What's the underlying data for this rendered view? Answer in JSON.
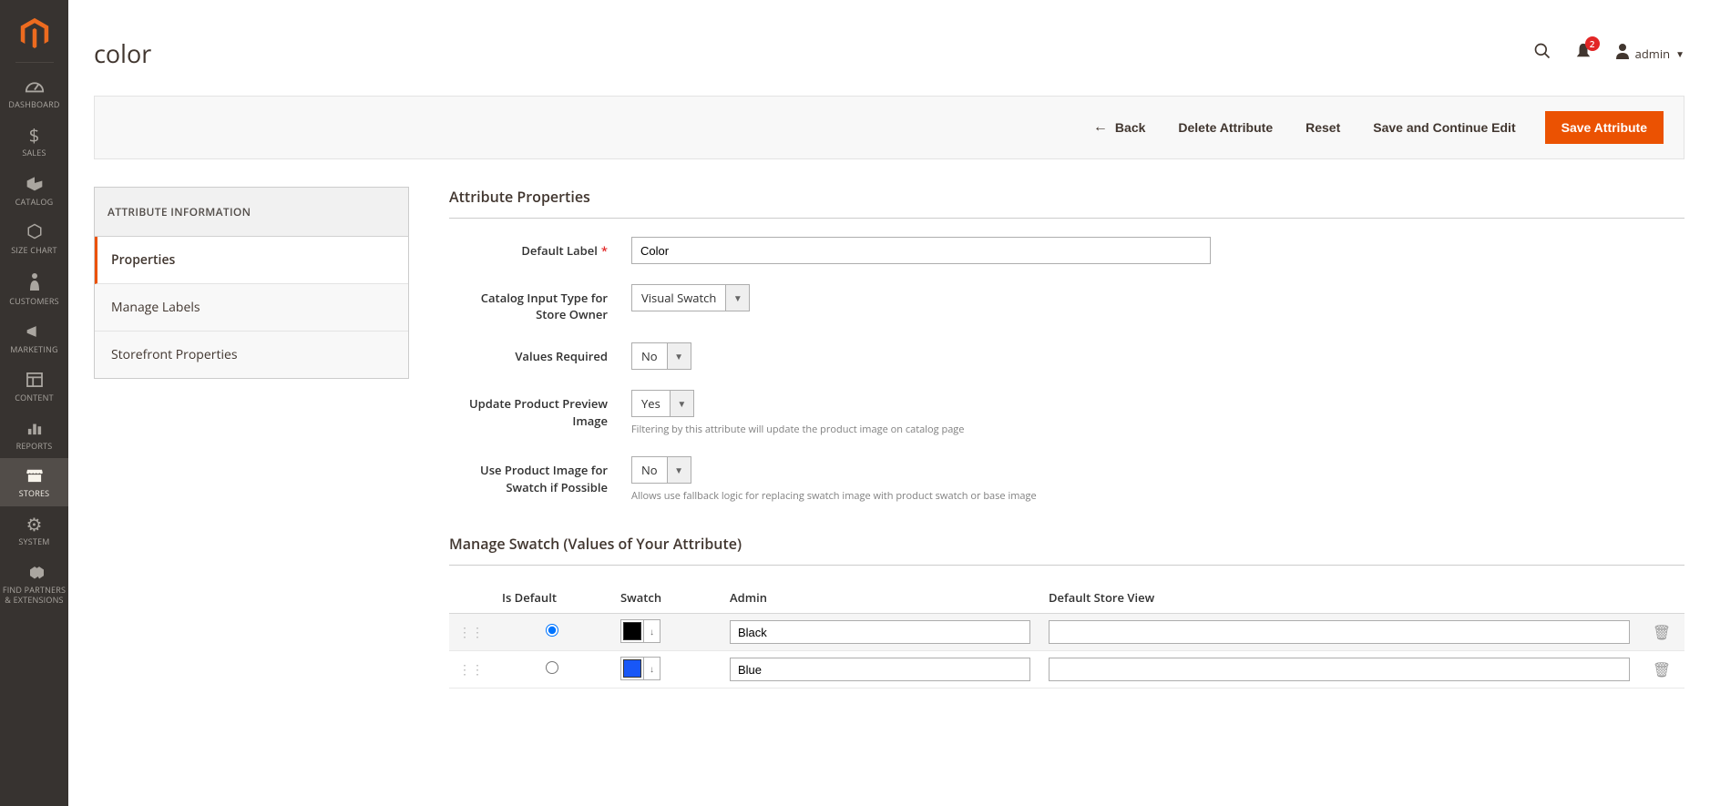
{
  "sidebar": {
    "items": [
      {
        "label": "DASHBOARD"
      },
      {
        "label": "SALES"
      },
      {
        "label": "CATALOG"
      },
      {
        "label": "SIZE CHART"
      },
      {
        "label": "CUSTOMERS"
      },
      {
        "label": "MARKETING"
      },
      {
        "label": "CONTENT"
      },
      {
        "label": "REPORTS"
      },
      {
        "label": "STORES"
      },
      {
        "label": "SYSTEM"
      },
      {
        "label": "FIND PARTNERS & EXTENSIONS"
      }
    ]
  },
  "header": {
    "title": "color",
    "notif_count": "2",
    "username": "admin"
  },
  "actions": {
    "back": "Back",
    "delete": "Delete Attribute",
    "reset": "Reset",
    "save_continue": "Save and Continue Edit",
    "save": "Save Attribute"
  },
  "tabs": {
    "header": "ATTRIBUTE INFORMATION",
    "items": [
      {
        "label": "Properties"
      },
      {
        "label": "Manage Labels"
      },
      {
        "label": "Storefront Properties"
      }
    ]
  },
  "form": {
    "section_title": "Attribute Properties",
    "default_label": {
      "label": "Default Label",
      "value": "Color"
    },
    "input_type": {
      "label": "Catalog Input Type for Store Owner",
      "value": "Visual Swatch"
    },
    "values_required": {
      "label": "Values Required",
      "value": "No"
    },
    "update_preview": {
      "label": "Update Product Preview Image",
      "value": "Yes",
      "help": "Filtering by this attribute will update the product image on catalog page"
    },
    "use_product_image": {
      "label": "Use Product Image for Swatch if Possible",
      "value": "No",
      "help": "Allows use fallback logic for replacing swatch image with product swatch or base image"
    }
  },
  "swatch": {
    "title": "Manage Swatch (Values of Your Attribute)",
    "columns": {
      "is_default": "Is Default",
      "swatch": "Swatch",
      "admin": "Admin",
      "default_store": "Default Store View"
    },
    "rows": [
      {
        "color": "#000000",
        "admin": "Black",
        "store": "",
        "is_default": true
      },
      {
        "color": "#1857f7",
        "admin": "Blue",
        "store": "",
        "is_default": false
      }
    ]
  }
}
